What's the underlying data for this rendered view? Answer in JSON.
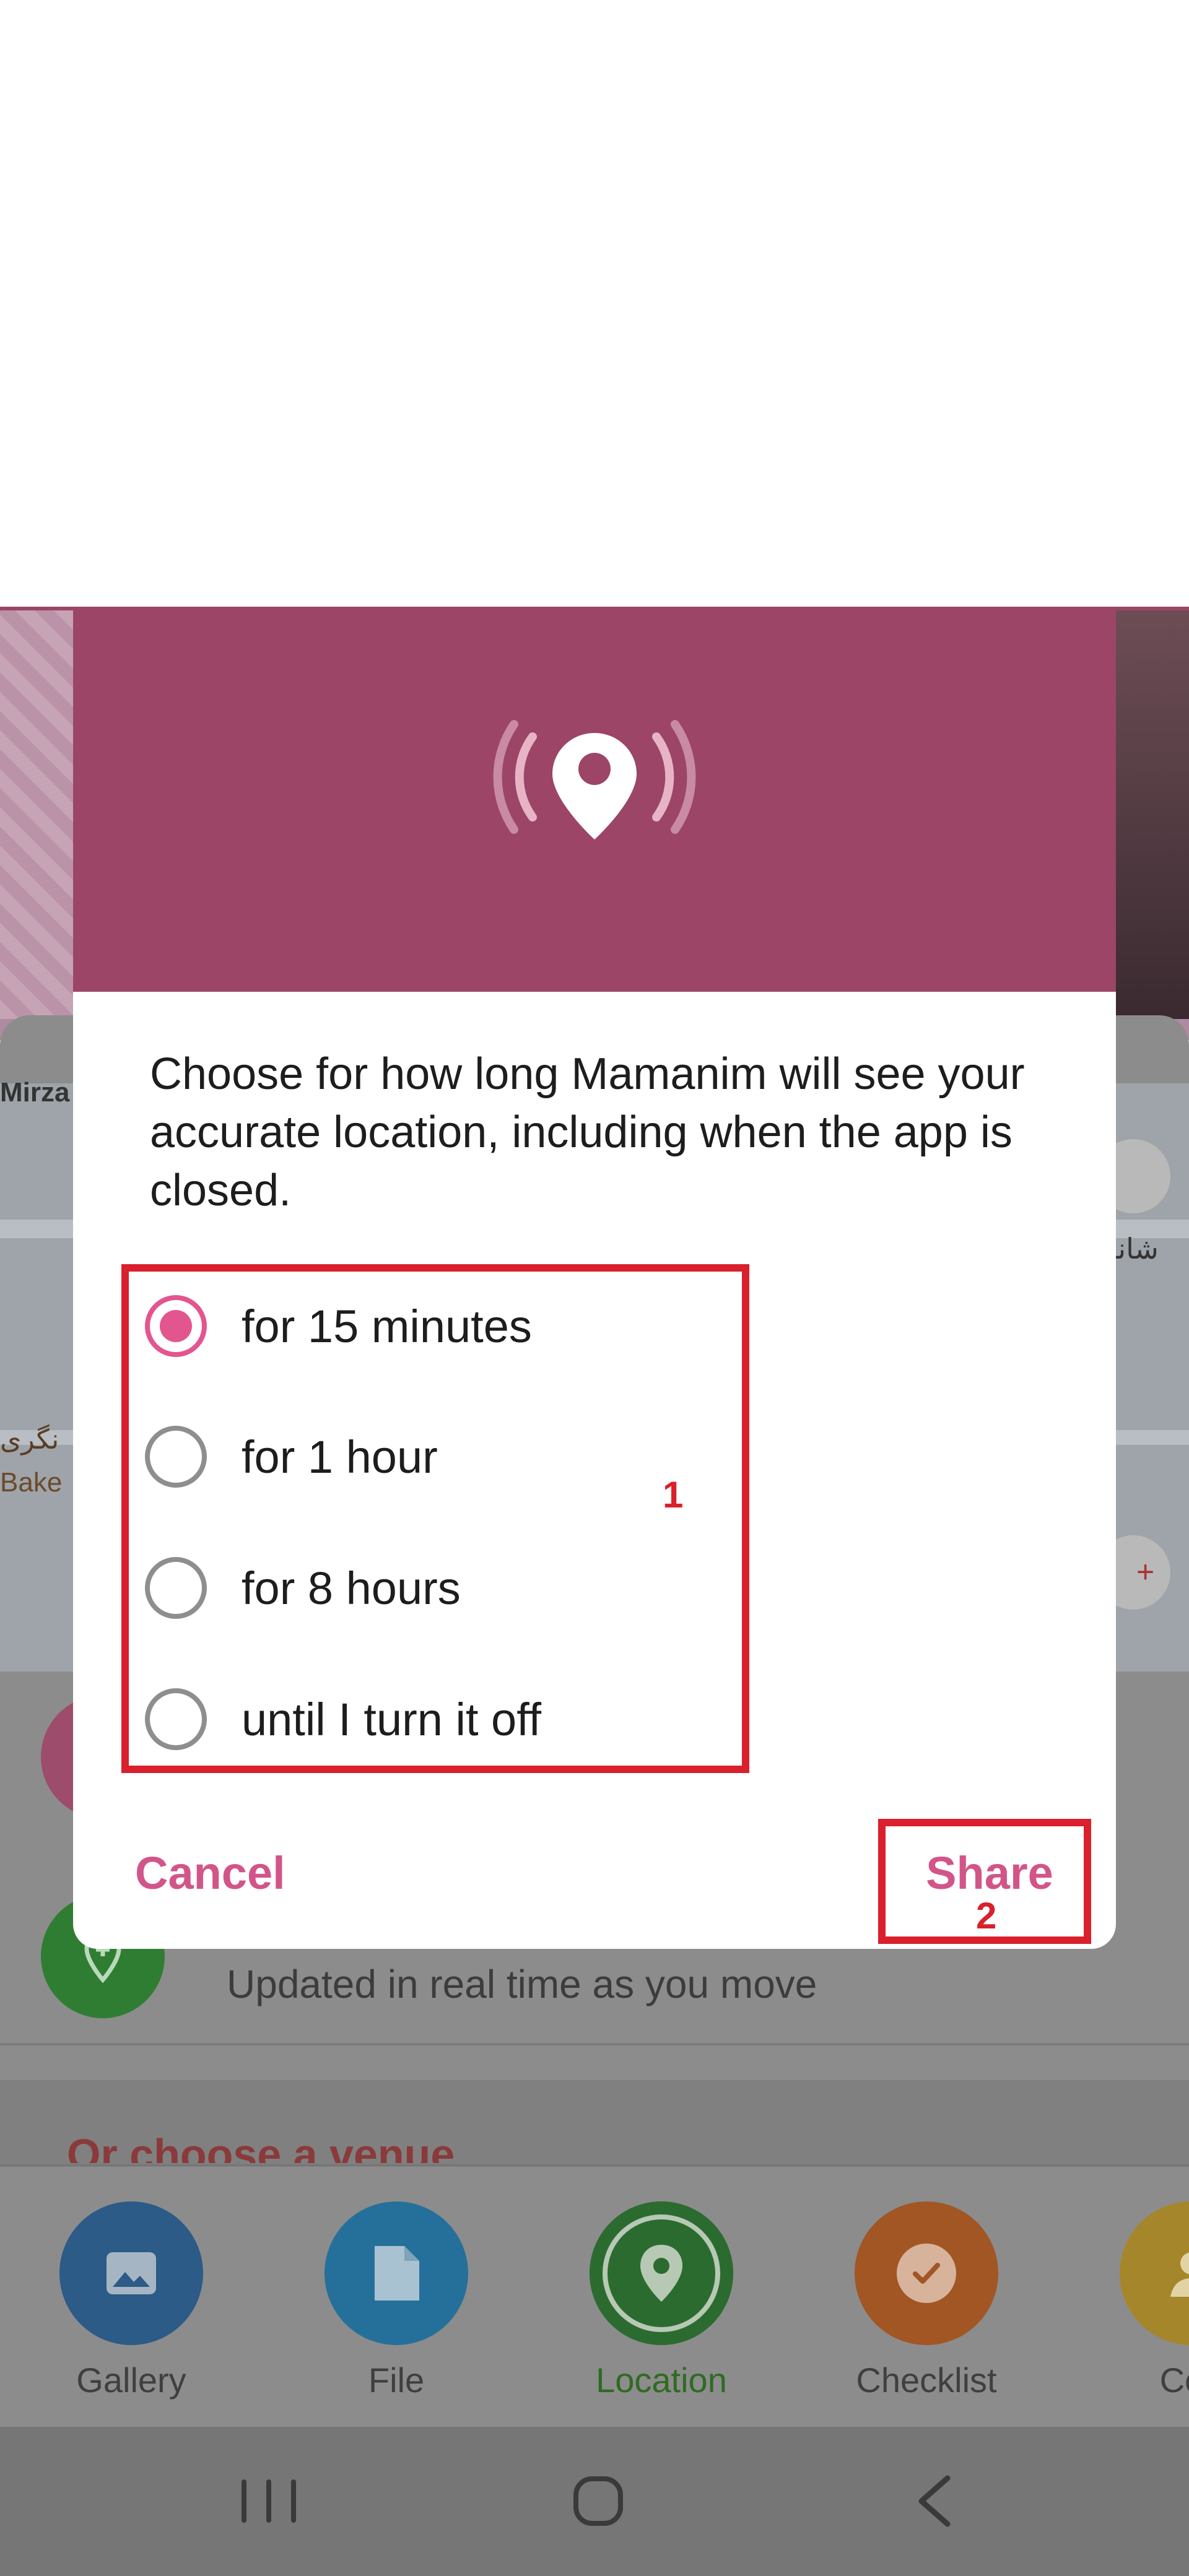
{
  "dialog": {
    "message": "Choose for how long Mamanim will see your accurate location, including when the app is closed.",
    "options": [
      {
        "label": "for 15 minutes",
        "selected": true
      },
      {
        "label": "for 1 hour",
        "selected": false
      },
      {
        "label": "for 8 hours",
        "selected": false
      },
      {
        "label": "until I turn it off",
        "selected": false
      }
    ],
    "cancel_label": "Cancel",
    "share_label": "Share",
    "header_color": "#9c4566",
    "accent_color": "#e3558f",
    "header_icon": "live-location-icon"
  },
  "annotations": {
    "box1": "1",
    "box2": "2"
  },
  "background": {
    "map_labels": {
      "mirza": "Mirza",
      "bakery": "Bake",
      "fa_left": "نگری",
      "fa_right": "شانز"
    },
    "live_location_subtitle": "Updated in real time as you move",
    "venue_heading": "Or choose a venue"
  },
  "attach": {
    "items": [
      {
        "label": "Gallery",
        "icon": "image-icon"
      },
      {
        "label": "File",
        "icon": "file-icon"
      },
      {
        "label": "Location",
        "icon": "location-pin-icon",
        "active": true
      },
      {
        "label": "Checklist",
        "icon": "checklist-icon"
      },
      {
        "label": "Con",
        "icon": "contact-icon"
      }
    ]
  },
  "navbar": {
    "icons": [
      "recents-icon",
      "home-icon",
      "back-icon"
    ]
  }
}
